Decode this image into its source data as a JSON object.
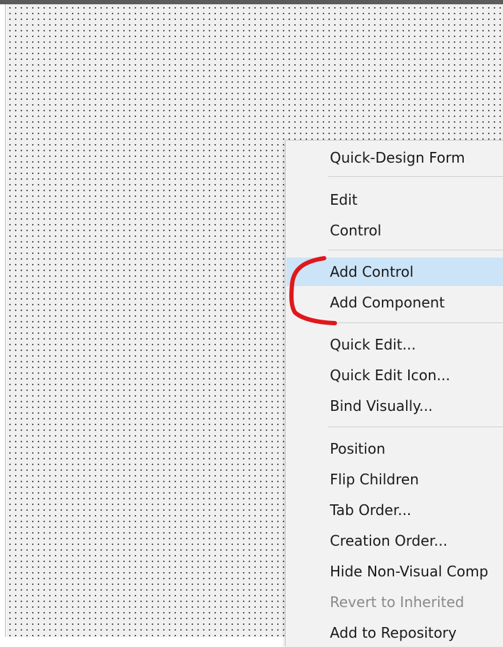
{
  "menu": {
    "items": [
      {
        "label": "Quick-Design Form"
      },
      {
        "label": "Edit"
      },
      {
        "label": "Control"
      },
      {
        "label": "Add Control"
      },
      {
        "label": "Add Component"
      },
      {
        "label": "Quick Edit..."
      },
      {
        "label": "Quick Edit Icon..."
      },
      {
        "label": "Bind Visually..."
      },
      {
        "label": "Position"
      },
      {
        "label": "Flip Children"
      },
      {
        "label": "Tab Order..."
      },
      {
        "label": "Creation Order..."
      },
      {
        "label": "Hide Non-Visual Comp"
      },
      {
        "label": "Revert to Inherited"
      },
      {
        "label": "Add to Repository"
      }
    ],
    "highlighted": "Add Control"
  },
  "colors": {
    "highlight": "#cce4f7",
    "menu_background": "#f2f2f2",
    "annotation": "#e0181b"
  }
}
